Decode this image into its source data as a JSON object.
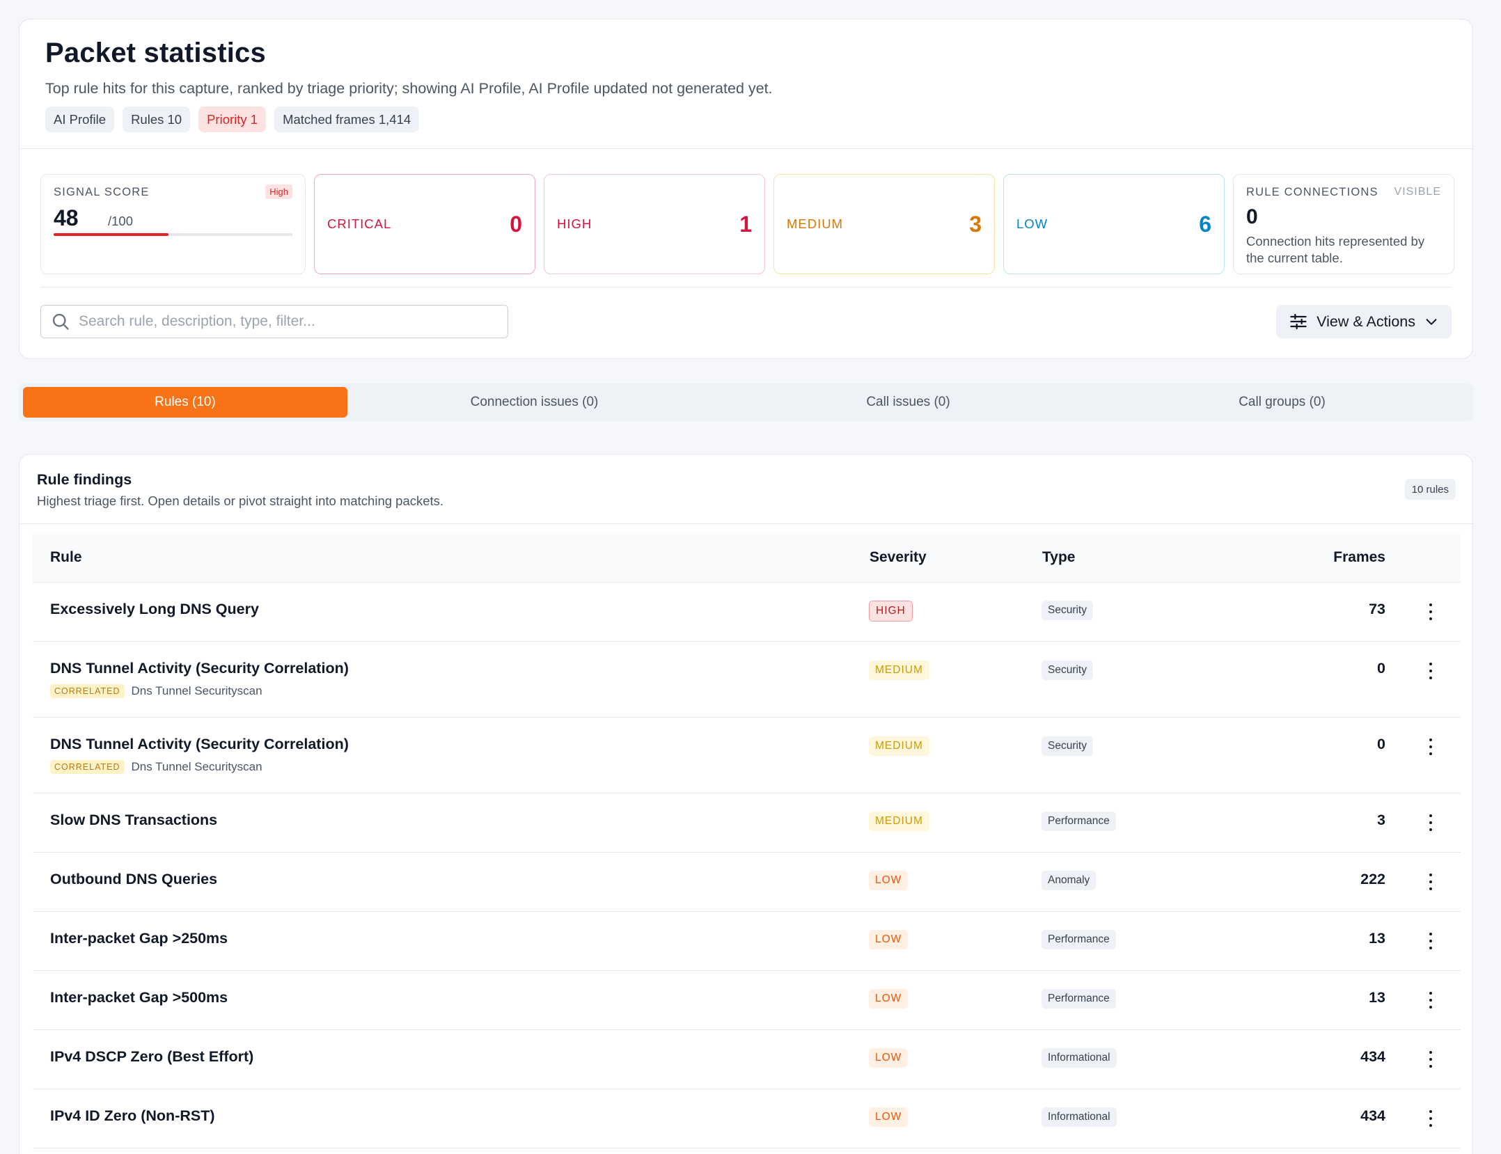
{
  "header": {
    "title": "Packet statistics",
    "subtitle": "Top rule hits for this capture, ranked by triage priority; showing AI Profile, AI Profile updated not generated yet.",
    "chips": [
      "AI Profile",
      "Rules 10",
      "Priority 1",
      "Matched frames 1,414"
    ]
  },
  "signal": {
    "label": "SIGNAL SCORE",
    "tag": "High",
    "score": "48",
    "of": "/100",
    "fraction": 0.48,
    "bar_color": "#e02424"
  },
  "severity_cards": [
    {
      "label": "CRITICAL",
      "count": "0",
      "color": "#d4143f"
    },
    {
      "label": "HIGH",
      "count": "1",
      "color": "#d4143f"
    },
    {
      "label": "MEDIUM",
      "count": "3",
      "color": "#d97706"
    },
    {
      "label": "LOW",
      "count": "6",
      "color": "#0284c7"
    }
  ],
  "rule_connections": {
    "label": "RULE CONNECTIONS",
    "visibility": "VISIBLE",
    "count": "0",
    "description": "Connection hits represented by the current table."
  },
  "search": {
    "placeholder": "Search rule, description, type, filter...",
    "value": ""
  },
  "view_actions": {
    "label": "View & Actions"
  },
  "tabs": [
    {
      "label": "Rules (10)",
      "active": true
    },
    {
      "label": "Connection issues (0)",
      "active": false
    },
    {
      "label": "Call issues (0)",
      "active": false
    },
    {
      "label": "Call groups (0)",
      "active": false
    }
  ],
  "findings": {
    "title": "Rule findings",
    "subtitle": "Highest triage first. Open details or pivot straight into matching packets.",
    "count_badge": "10 rules",
    "columns": {
      "rule": "Rule",
      "severity": "Severity",
      "type": "Type",
      "frames": "Frames"
    },
    "rows": [
      {
        "rule": "Excessively Long DNS Query",
        "severity": "HIGH",
        "type": "Security",
        "frames": "73",
        "correlated": null
      },
      {
        "rule": "DNS Tunnel Activity (Security Correlation)",
        "severity": "MEDIUM",
        "type": "Security",
        "frames": "0",
        "correlated": {
          "tag": "CORRELATED",
          "text": "Dns Tunnel Securityscan"
        }
      },
      {
        "rule": "DNS Tunnel Activity (Security Correlation)",
        "severity": "MEDIUM",
        "type": "Security",
        "frames": "0",
        "correlated": {
          "tag": "CORRELATED",
          "text": "Dns Tunnel Securityscan"
        }
      },
      {
        "rule": "Slow DNS Transactions",
        "severity": "MEDIUM",
        "type": "Performance",
        "frames": "3",
        "correlated": null
      },
      {
        "rule": "Outbound DNS Queries",
        "severity": "LOW",
        "type": "Anomaly",
        "frames": "222",
        "correlated": null
      },
      {
        "rule": "Inter-packet Gap >250ms",
        "severity": "LOW",
        "type": "Performance",
        "frames": "13",
        "correlated": null
      },
      {
        "rule": "Inter-packet Gap >500ms",
        "severity": "LOW",
        "type": "Performance",
        "frames": "13",
        "correlated": null
      },
      {
        "rule": "IPv4 DSCP Zero (Best Effort)",
        "severity": "LOW",
        "type": "Informational",
        "frames": "434",
        "correlated": null
      },
      {
        "rule": "IPv4 ID Zero (Non-RST)",
        "severity": "LOW",
        "type": "Informational",
        "frames": "434",
        "correlated": null
      }
    ]
  },
  "colors": {
    "accent": "#f97316",
    "critical": "#d4143f",
    "medium": "#d97706",
    "low": "#0284c7"
  }
}
